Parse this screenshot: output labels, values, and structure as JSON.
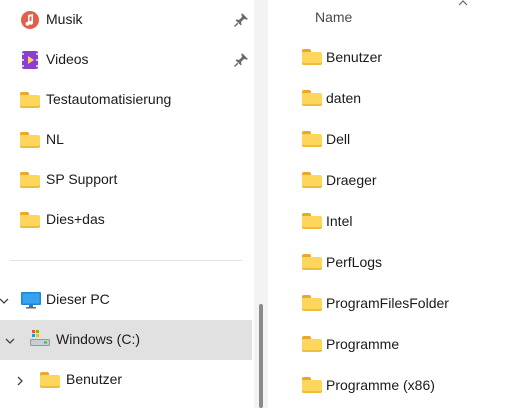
{
  "nav": {
    "quick_access": [
      {
        "label": "Musik",
        "icon": "music-icon",
        "pinned": true
      },
      {
        "label": "Videos",
        "icon": "videos-icon",
        "pinned": true
      },
      {
        "label": "Testautomatisierung",
        "icon": "folder-icon",
        "pinned": false
      },
      {
        "label": "NL",
        "icon": "folder-icon",
        "pinned": false
      },
      {
        "label": "SP Support",
        "icon": "folder-icon",
        "pinned": false
      },
      {
        "label": "Dies+das",
        "icon": "folder-icon",
        "pinned": false
      }
    ],
    "this_pc": {
      "label": "Dieser PC",
      "icon": "computer-icon",
      "expanded": true
    },
    "drive": {
      "label": "Windows (C:)",
      "icon": "drive-icon",
      "expanded": true,
      "selected": true
    },
    "subfolder": {
      "label": "Benutzer",
      "icon": "folder-icon",
      "expanded": false
    }
  },
  "content": {
    "column_header": "Name",
    "sort_indicator": "chevron-up-icon",
    "items": [
      {
        "label": "Benutzer"
      },
      {
        "label": "daten"
      },
      {
        "label": "Dell"
      },
      {
        "label": "Draeger"
      },
      {
        "label": "Intel"
      },
      {
        "label": "PerfLogs"
      },
      {
        "label": "ProgramFilesFolder"
      },
      {
        "label": "Programme"
      },
      {
        "label": "Programme (x86)"
      }
    ]
  },
  "colors": {
    "folder": "#ffd65c",
    "selection": "#e1e1e1",
    "music_icon": "#e05a4a",
    "videos_icon": "#8a3fd1"
  }
}
